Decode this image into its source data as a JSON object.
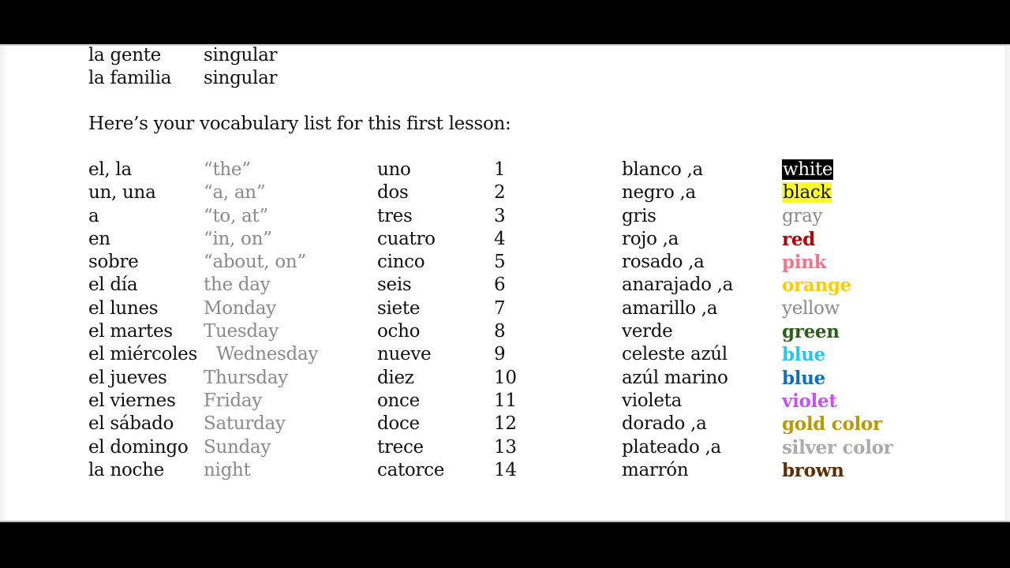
{
  "intro_rows": [
    {
      "word": "la gente",
      "note": "singular"
    },
    {
      "word": "la familia",
      "note": "singular"
    }
  ],
  "heading": "Here’s your vocabulary list for this first lesson:",
  "vocab_col1": [
    {
      "es": "el, la",
      "en": "“the”"
    },
    {
      "es": "un, una",
      "en": "“a, an”"
    },
    {
      "es": "a",
      "en": "“to, at”"
    },
    {
      "es": "en",
      "en": "“in, on”"
    },
    {
      "es": "sobre",
      "en": "“about, on”"
    },
    {
      "es": "el día",
      "en": "the day"
    },
    {
      "es": "el lunes",
      "en": "Monday"
    },
    {
      "es": "el martes",
      "en": "Tuesday"
    },
    {
      "es": "el miércoles",
      "en": "Wednesday"
    },
    {
      "es": "el jueves",
      "en": "Thursday"
    },
    {
      "es": "el viernes",
      "en": "Friday"
    },
    {
      "es": "el sábado",
      "en": "Saturday"
    },
    {
      "es": "el domingo",
      "en": "Sunday"
    },
    {
      "es": "la noche",
      "en": "night"
    }
  ],
  "vocab_numbers": [
    {
      "es": "uno",
      "num": "1"
    },
    {
      "es": "dos",
      "num": "2"
    },
    {
      "es": "tres",
      "num": "3"
    },
    {
      "es": "cuatro",
      "num": "4"
    },
    {
      "es": "cinco",
      "num": "5"
    },
    {
      "es": "seis",
      "num": "6"
    },
    {
      "es": "siete",
      "num": "7"
    },
    {
      "es": "ocho",
      "num": "8"
    },
    {
      "es": "nueve",
      "num": "9"
    },
    {
      "es": "diez",
      "num": "10"
    },
    {
      "es": "once",
      "num": "11"
    },
    {
      "es": "doce",
      "num": "12"
    },
    {
      "es": "trece",
      "num": "13"
    },
    {
      "es": "catorce",
      "num": "14"
    }
  ],
  "vocab_colors": [
    {
      "es": "blanco ,a",
      "en": "white",
      "color": "#ffffff",
      "bg": "#000000",
      "bold": false
    },
    {
      "es": "negro ,a",
      "en": "black",
      "color": "#111111",
      "bg": "#ffff2e",
      "bold": false
    },
    {
      "es": "gris",
      "en": "gray",
      "color": "#8a8a8a",
      "bg": null,
      "bold": false
    },
    {
      "es": "rojo ,a",
      "en": "red",
      "color": "#b00000",
      "bg": null,
      "bold": true
    },
    {
      "es": "rosado ,a",
      "en": "pink",
      "color": "#f7738c",
      "bg": null,
      "bold": true
    },
    {
      "es": "anarajado ,a",
      "en": "orange",
      "color": "#ffcc00",
      "bg": null,
      "bold": true
    },
    {
      "es": "amarillo ,a",
      "en": "yellow",
      "color": "#8a8a8a",
      "bg": null,
      "bold": false
    },
    {
      "es": "verde",
      "en": "green",
      "color": "#2e5e1e",
      "bg": null,
      "bold": true
    },
    {
      "es": "celeste azúl",
      "en": "blue",
      "color": "#22c6f2",
      "bg": null,
      "bold": true
    },
    {
      "es": "azúl marino",
      "en": "blue",
      "color": "#0e6fbf",
      "bg": null,
      "bold": true
    },
    {
      "es": "violeta",
      "en": "violet",
      "color": "#c552f2",
      "bg": null,
      "bold": true
    },
    {
      "es": "dorado ,a",
      "en": "gold color",
      "color": "#b59a00",
      "bg": null,
      "bold": true
    },
    {
      "es": "plateado ,a",
      "en": "silver color",
      "color": "#ababab",
      "bg": null,
      "bold": true
    },
    {
      "es": "marrón",
      "en": "brown",
      "color": "#5a2e00",
      "bg": null,
      "bold": true
    }
  ]
}
